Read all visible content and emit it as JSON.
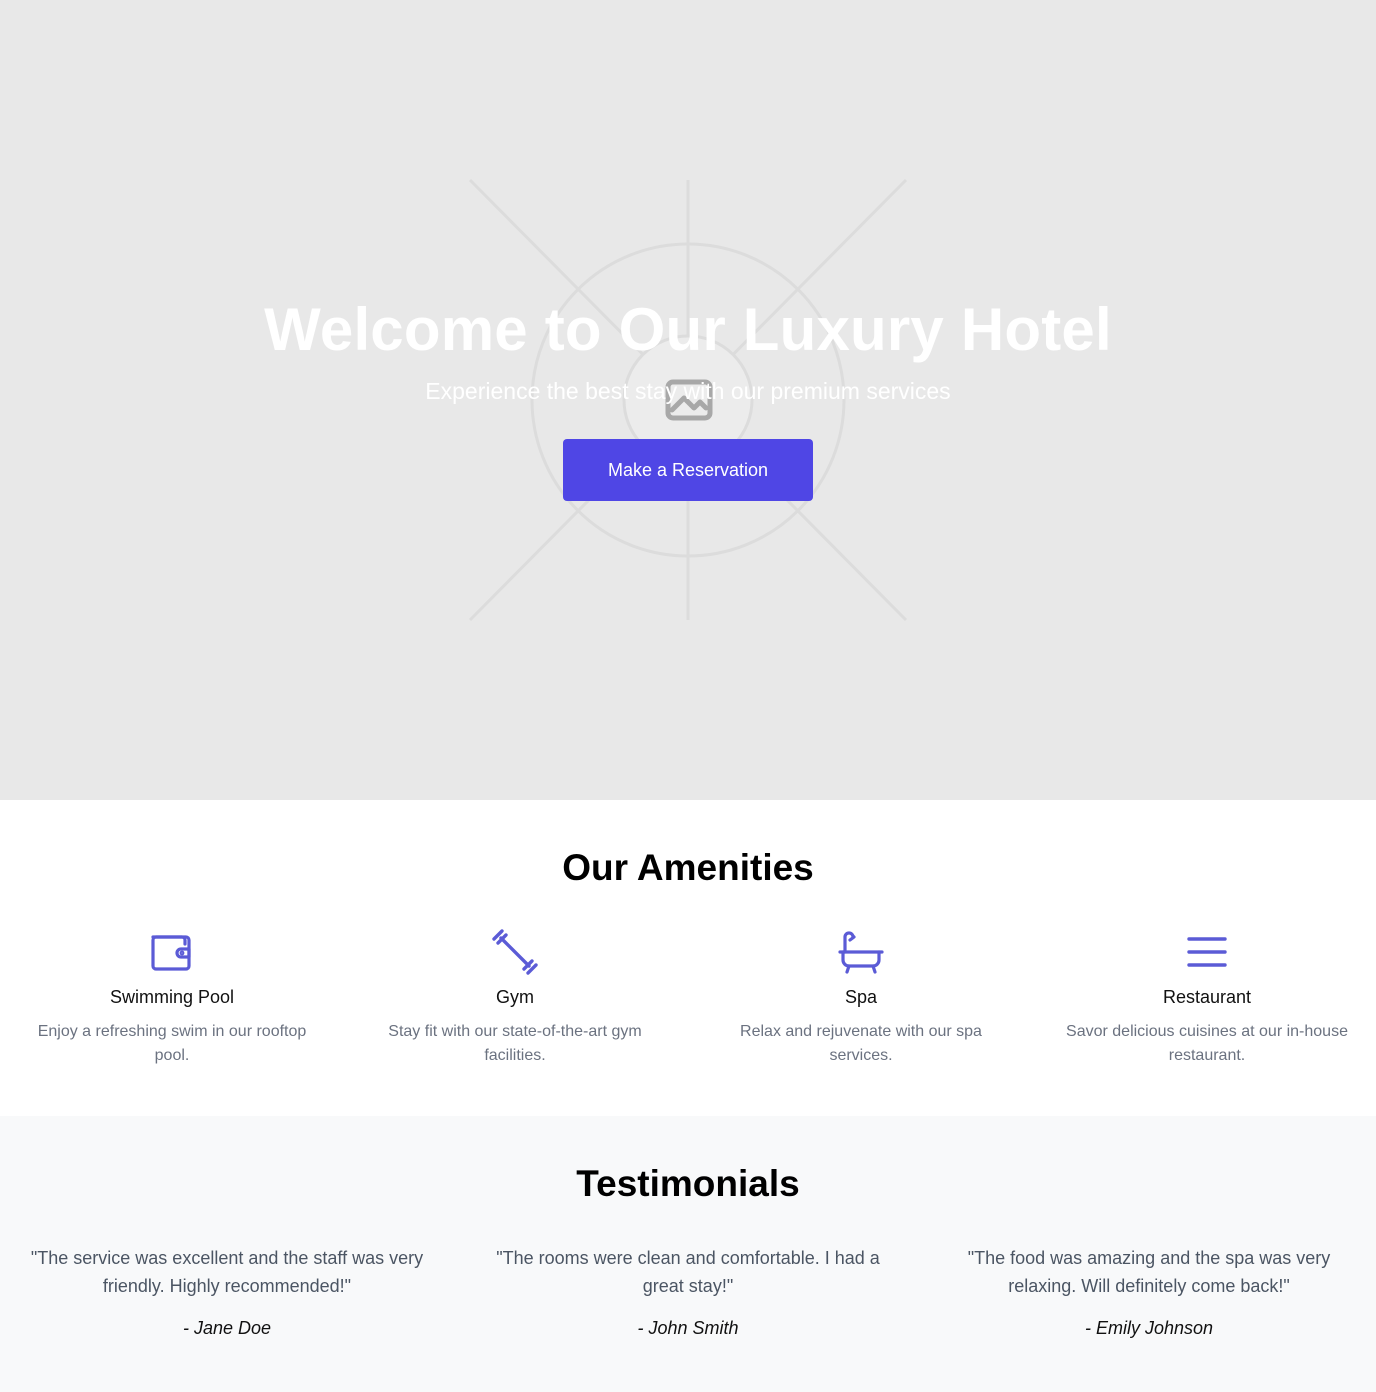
{
  "hero": {
    "title": "Welcome to Our Luxury Hotel",
    "subtitle": "Experience the best stay with our premium services",
    "button_label": "Make a Reservation",
    "background_image_icon": "image-placeholder-icon"
  },
  "amenities": {
    "title": "Our Amenities",
    "items": [
      {
        "icon": "wallet-icon",
        "name": "Swimming Pool",
        "description": "Enjoy a refreshing swim in our rooftop pool."
      },
      {
        "icon": "dumbbell-icon",
        "name": "Gym",
        "description": "Stay fit with our state-of-the-art gym facilities."
      },
      {
        "icon": "bathtub-icon",
        "name": "Spa",
        "description": "Relax and rejuvenate with our spa services."
      },
      {
        "icon": "menu-icon",
        "name": "Restaurant",
        "description": "Savor delicious cuisines at our in-house restaurant."
      }
    ]
  },
  "testimonials": {
    "title": "Testimonials",
    "items": [
      {
        "quote": "\"The service was excellent and the staff was very friendly. Highly recommended!\"",
        "author": "- Jane Doe"
      },
      {
        "quote": "\"The rooms were clean and comfortable. I had a great stay!\"",
        "author": "- John Smith"
      },
      {
        "quote": "\"The food was amazing and the spa was very relaxing. Will definitely come back!\"",
        "author": "- Emily Johnson"
      }
    ]
  },
  "colors": {
    "accent": "#4f46e5",
    "icon": "#5b5bd6",
    "hero_bg": "#e8e8e8",
    "muted_text": "#6b7280",
    "testimonial_bg": "#f8f9fa"
  }
}
